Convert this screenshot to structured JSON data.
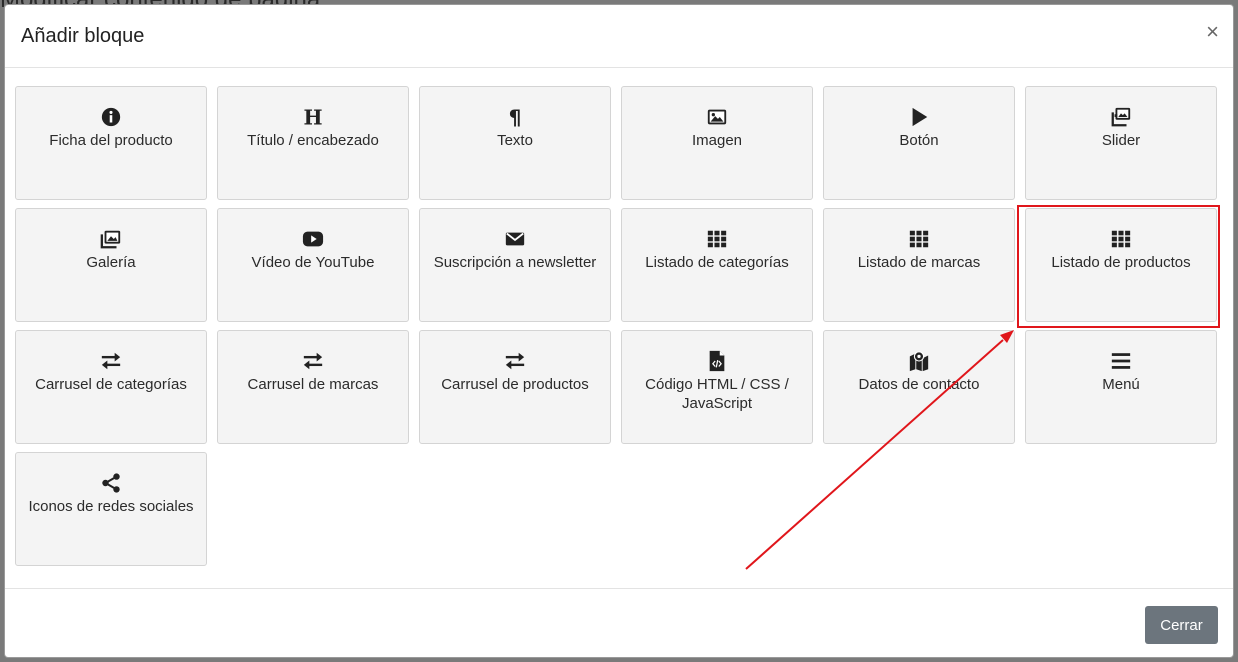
{
  "background": {
    "page_title": "Modificar contenido de página"
  },
  "modal": {
    "title": "Añadir bloque",
    "close_symbol": "×",
    "close_label": "Cerrar"
  },
  "blocks": [
    {
      "label": "Ficha del producto",
      "icon": "info-circle-icon"
    },
    {
      "label": "Título / encabezado",
      "icon": "heading-icon"
    },
    {
      "label": "Texto",
      "icon": "paragraph-icon"
    },
    {
      "label": "Imagen",
      "icon": "image-icon"
    },
    {
      "label": "Botón",
      "icon": "play-icon"
    },
    {
      "label": "Slider",
      "icon": "images-icon"
    },
    {
      "label": "Galería",
      "icon": "gallery-icon"
    },
    {
      "label": "Vídeo de YouTube",
      "icon": "youtube-icon"
    },
    {
      "label": "Suscripción a newsletter",
      "icon": "envelope-icon"
    },
    {
      "label": "Listado de categorías",
      "icon": "grid-icon"
    },
    {
      "label": "Listado de marcas",
      "icon": "grid-icon"
    },
    {
      "label": "Listado de productos",
      "icon": "grid-icon"
    },
    {
      "label": "Carrusel de categorías",
      "icon": "exchange-icon"
    },
    {
      "label": "Carrusel de marcas",
      "icon": "exchange-icon"
    },
    {
      "label": "Carrusel de productos",
      "icon": "exchange-icon"
    },
    {
      "label": "Código HTML / CSS / JavaScript",
      "icon": "file-code-icon"
    },
    {
      "label": "Datos de contacto",
      "icon": "map-marker-icon"
    },
    {
      "label": "Menú",
      "icon": "bars-icon"
    },
    {
      "label": "Iconos de redes sociales",
      "icon": "share-icon"
    }
  ],
  "annotation": {
    "highlighted_block": "Listado de productos",
    "color": "#e0161b"
  }
}
